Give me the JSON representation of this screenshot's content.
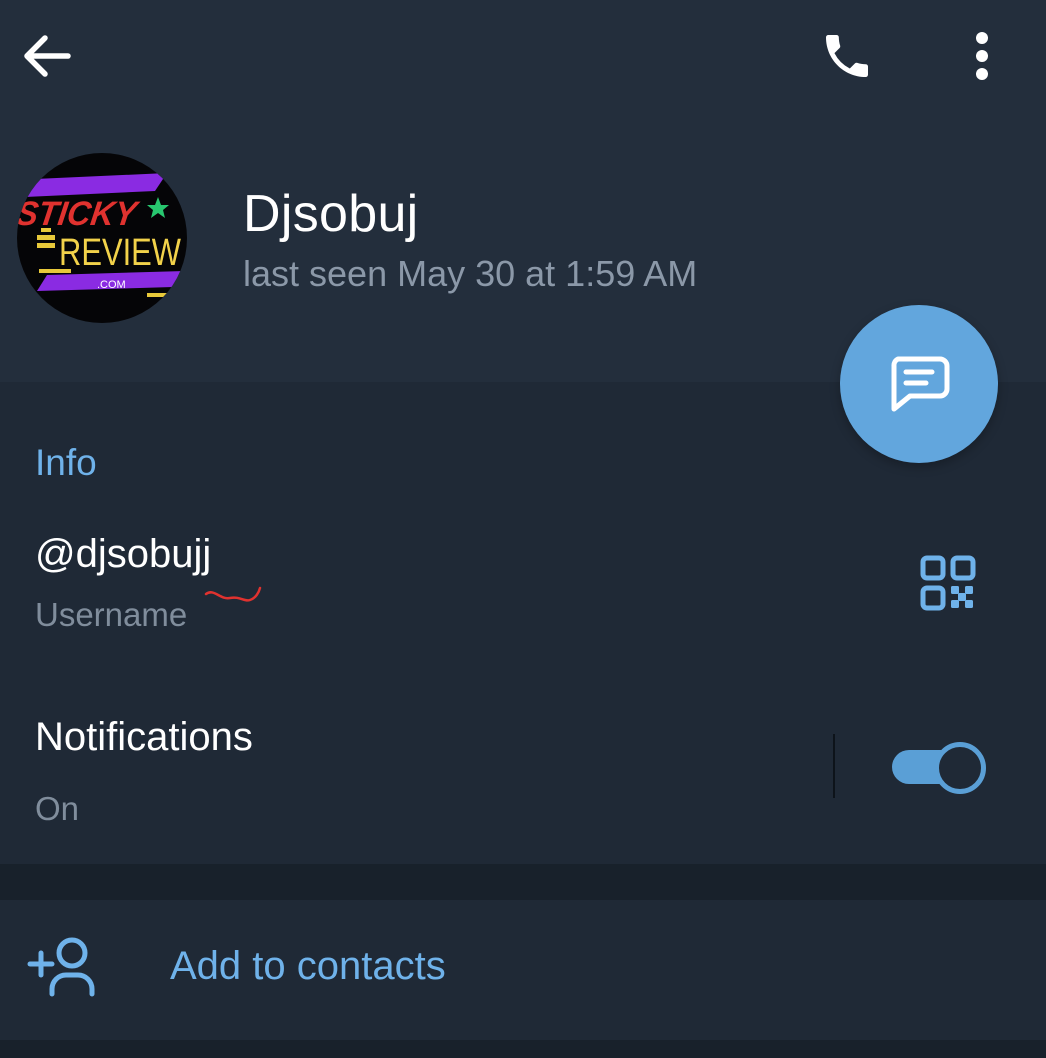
{
  "header": {
    "back_icon": "arrow-left-icon",
    "call_icon": "phone-icon",
    "more_icon": "more-vertical-icon"
  },
  "profile": {
    "name": "Djsobuj",
    "last_seen": "last seen May 30 at 1:59 AM",
    "avatar": {
      "line1": "STICKY",
      "line2": "REVIEW",
      "line3": ".COM"
    }
  },
  "fab": {
    "icon": "message-icon"
  },
  "info": {
    "title": "Info",
    "username": {
      "value": "@djsobujj",
      "label": "Username",
      "qr_icon": "qr-code-icon"
    },
    "notifications": {
      "label": "Notifications",
      "status": "On",
      "enabled": true
    }
  },
  "actions": {
    "add_contact": {
      "label": "Add to contacts",
      "icon": "add-user-icon"
    }
  },
  "colors": {
    "background": "#1d2733",
    "header": "#232e3c",
    "section": "#1f2936",
    "accent": "#6fb2ea",
    "fab": "#62a6dd",
    "muted_text": "#808d9c"
  }
}
